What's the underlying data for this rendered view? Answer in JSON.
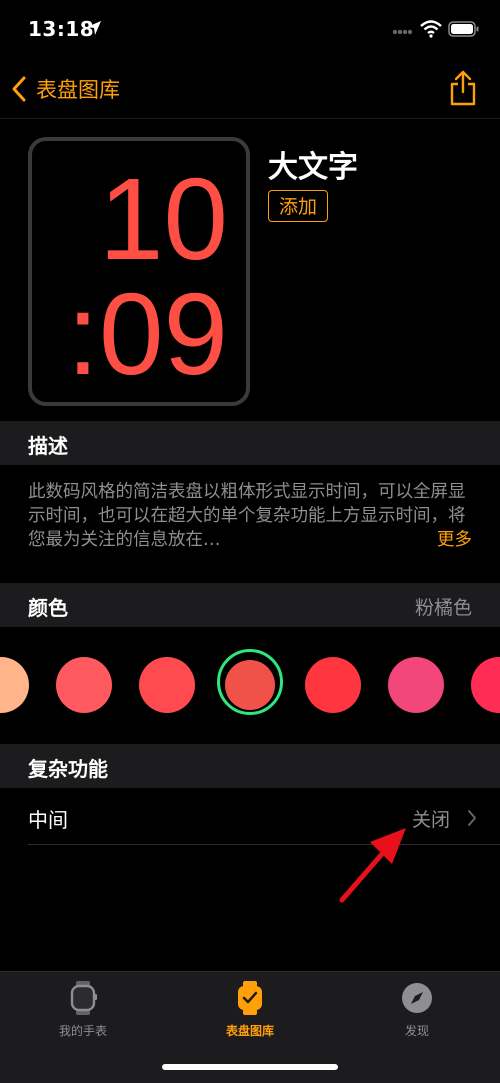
{
  "status_bar": {
    "time": "13:18"
  },
  "nav": {
    "back_label": "表盘图库"
  },
  "watch_face": {
    "hour": "10",
    "minute": ":09",
    "title": "大文字",
    "add_label": "添加"
  },
  "description": {
    "header": "描述",
    "text": "此数码风格的简洁表盘以粗体形式显示时间，可以全屏显示时间，也可以在超大的单个复杂功能上方显示时间，将您最为关注的信息放在…",
    "more_label": "更多"
  },
  "color": {
    "header": "颜色",
    "selected_name": "粉橘色",
    "swatches": [
      "#ffb48a",
      "#ff5a60",
      "#ff4b4f",
      "#f0524a",
      "#ff3640",
      "#f2477a",
      "#ff2d55"
    ],
    "selected_index": 3,
    "ring_color": "#2ee67b"
  },
  "complications": {
    "header": "复杂功能",
    "items": [
      {
        "label": "中间",
        "value": "关闭"
      }
    ]
  },
  "tabbar": {
    "tabs": [
      {
        "label": "我的手表",
        "icon": "watch-icon",
        "active": false
      },
      {
        "label": "表盘图库",
        "icon": "watch-face-icon",
        "active": true
      },
      {
        "label": "发现",
        "icon": "compass-icon",
        "active": false
      }
    ]
  },
  "accent_color": "#ff9f0a"
}
